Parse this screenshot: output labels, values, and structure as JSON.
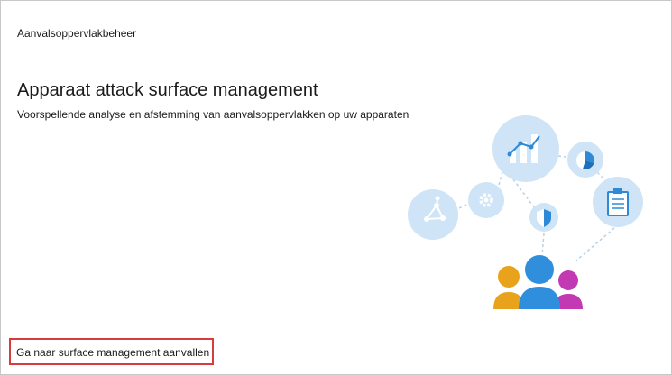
{
  "header": {
    "title": "Aanvalsoppervlakbeheer"
  },
  "main": {
    "title": "Apparaat attack surface management",
    "subtitle": "Voorspellende analyse en afstemming van aanvalsoppervlakken op uw apparaten",
    "link": "Ga naar surface management aanvallen"
  },
  "illustration": {
    "icons": [
      "bar-chart-icon",
      "pie-chart-icon",
      "settings-gear-icon",
      "network-graph-icon",
      "clipboard-list-icon",
      "shield-icon",
      "people-group-icon"
    ]
  },
  "colors": {
    "circle_fill": "#cfe4f7",
    "accent_blue": "#2d8ad9",
    "person_orange": "#e8a21c",
    "person_blue": "#2f8fdd",
    "person_magenta": "#c239b3",
    "highlight_red": "#d93a3a"
  }
}
